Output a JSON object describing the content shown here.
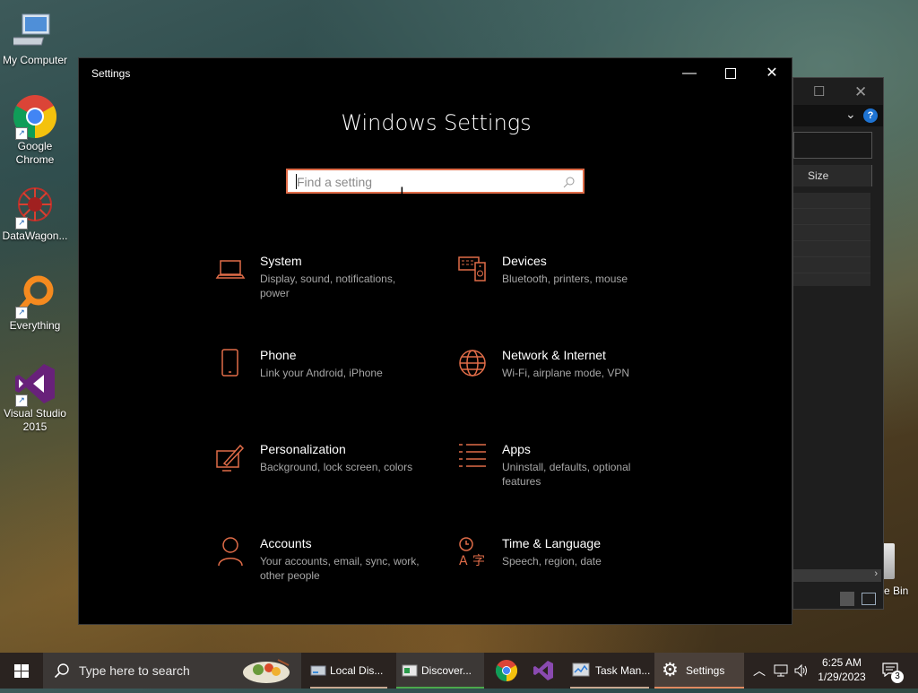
{
  "desktop": {
    "icons": [
      {
        "label": "My Computer",
        "icon": "computer-icon"
      },
      {
        "label": "Google Chrome",
        "icon": "chrome-icon"
      },
      {
        "label": "DataWagon...",
        "icon": "datawagon-icon"
      },
      {
        "label": "Everything",
        "icon": "everything-icon"
      },
      {
        "label": "Visual Studio 2015",
        "icon": "visual-studio-icon"
      }
    ],
    "recycle_bin_label": "e Bin"
  },
  "background_window": {
    "size_column": "Size"
  },
  "settings": {
    "window_title": "Settings",
    "heading": "Windows Settings",
    "search_placeholder": "Find a setting",
    "accent_color": "#e06c48",
    "categories": [
      {
        "name": "System",
        "desc": "Display, sound, notifications, power",
        "icon": "laptop-icon"
      },
      {
        "name": "Devices",
        "desc": "Bluetooth, printers, mouse",
        "icon": "devices-icon"
      },
      {
        "name": "Phone",
        "desc": "Link your Android, iPhone",
        "icon": "phone-icon"
      },
      {
        "name": "Network & Internet",
        "desc": "Wi-Fi, airplane mode, VPN",
        "icon": "globe-icon"
      },
      {
        "name": "Personalization",
        "desc": "Background, lock screen, colors",
        "icon": "paintbrush-icon"
      },
      {
        "name": "Apps",
        "desc": "Uninstall, defaults, optional features",
        "icon": "apps-list-icon"
      },
      {
        "name": "Accounts",
        "desc": "Your accounts, email, sync, work, other people",
        "icon": "person-icon"
      },
      {
        "name": "Time & Language",
        "desc": "Speech, region, date",
        "icon": "time-language-icon"
      }
    ]
  },
  "taskbar": {
    "search_placeholder": "Type here to search",
    "items": [
      {
        "label": "Local Dis...",
        "icon": "drive-icon"
      },
      {
        "label": "Discover...",
        "icon": "discover-icon"
      },
      {
        "label": "",
        "icon": "chrome-icon"
      },
      {
        "label": "",
        "icon": "visual-studio-icon"
      },
      {
        "label": "Task Man...",
        "icon": "task-manager-icon"
      },
      {
        "label": "Settings",
        "icon": "gear-icon"
      }
    ],
    "time": "6:25 AM",
    "date": "1/29/2023",
    "notification_count": "3"
  }
}
